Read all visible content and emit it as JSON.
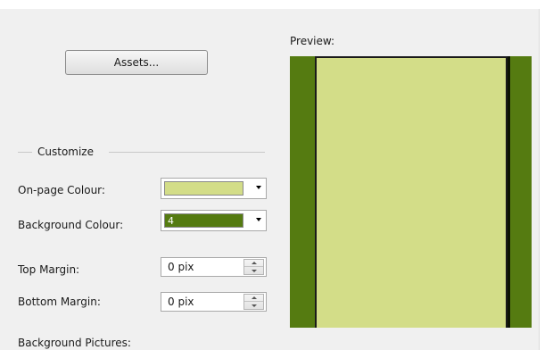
{
  "clipped_top_label": "",
  "assets_button": {
    "label": "Assets..."
  },
  "preview": {
    "label": "Preview:"
  },
  "customize": {
    "group_label": "Customize",
    "on_page_colour": {
      "label": "On-page Colour:",
      "color": "#d3dd88",
      "text": ""
    },
    "background_colour": {
      "label": "Background Colour:",
      "color": "#557b11",
      "text": "4"
    },
    "top_margin": {
      "label": "Top Margin:",
      "value": "0 pix"
    },
    "bottom_margin": {
      "label": "Bottom Margin:",
      "value": "0 pix"
    }
  },
  "background_pictures": {
    "label": "Background Pictures:"
  },
  "icons": [
    "dropdown-arrow-icon",
    "spin-up-icon",
    "spin-down-icon"
  ]
}
